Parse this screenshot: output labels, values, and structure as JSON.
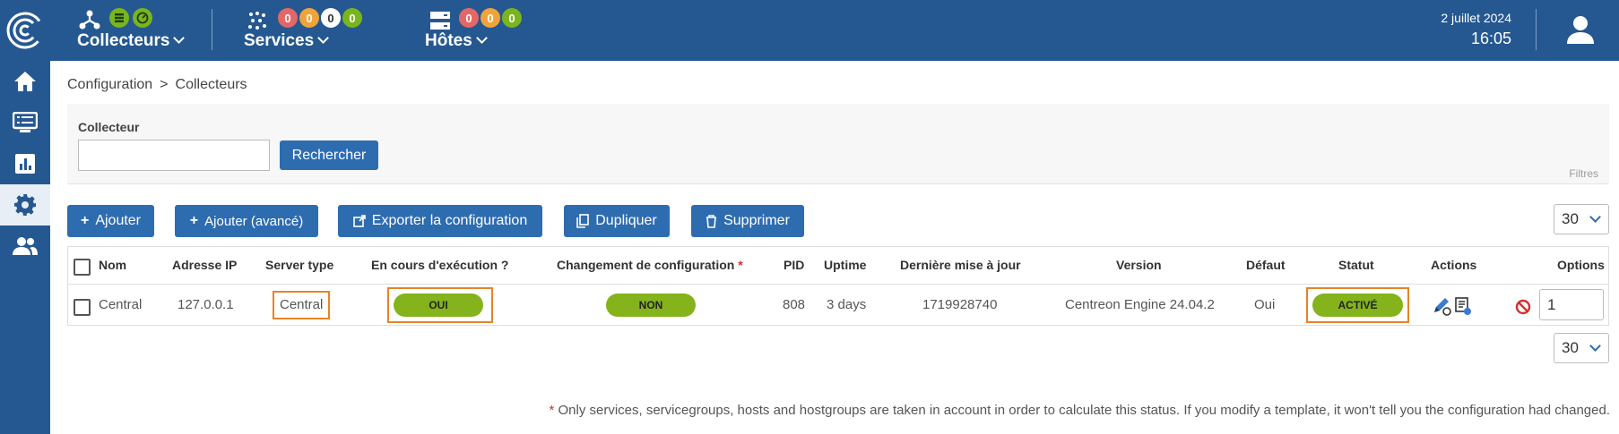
{
  "topbar": {
    "collectors": {
      "label": "Collecteurs"
    },
    "services": {
      "label": "Services",
      "counts": [
        "0",
        "0",
        "0",
        "0"
      ]
    },
    "hosts": {
      "label": "Hôtes",
      "counts": [
        "0",
        "0",
        "0"
      ]
    },
    "date": "2 juillet 2024",
    "time": "16:05"
  },
  "breadcrumb": {
    "root": "Configuration",
    "separator": ">",
    "current": "Collecteurs"
  },
  "filter": {
    "label": "Collecteur",
    "input_value": "",
    "search_button": "Rechercher",
    "filters_label": "Filtres"
  },
  "actions": {
    "add": "Ajouter",
    "add_advanced": "Ajouter (avancé)",
    "export": "Exporter la configuration",
    "duplicate": "Dupliquer",
    "delete": "Supprimer"
  },
  "pagination": {
    "per_page": "30"
  },
  "table": {
    "headers": {
      "name": "Nom",
      "ip": "Adresse IP",
      "server_type": "Server type",
      "running": "En cours d'exécution ?",
      "config_change": "Changement de configuration",
      "config_change_marker": "*",
      "pid": "PID",
      "uptime": "Uptime",
      "last_update": "Dernière mise à jour",
      "version": "Version",
      "default": "Défaut",
      "status": "Statut",
      "actions": "Actions",
      "options": "Options"
    },
    "rows": [
      {
        "name": "Central",
        "ip": "127.0.0.1",
        "server_type": "Central",
        "running": "OUI",
        "config_change": "NON",
        "pid": "808",
        "uptime": "3 days",
        "last_update": "1719928740",
        "version": "Centreon Engine 24.04.2",
        "default": "Oui",
        "status": "ACTIVÉ",
        "option_value": "1"
      }
    ]
  },
  "footnote": {
    "star": "*",
    "text": "Only services, servicegroups, hosts and hostgroups are taken in account in order to calculate this status. If you modify a template, it won't tell you the configuration had changed."
  },
  "colors": {
    "primary": "#255891",
    "button": "#2e6cb0",
    "status_green": "#84b31b",
    "highlight": "#e58428"
  }
}
